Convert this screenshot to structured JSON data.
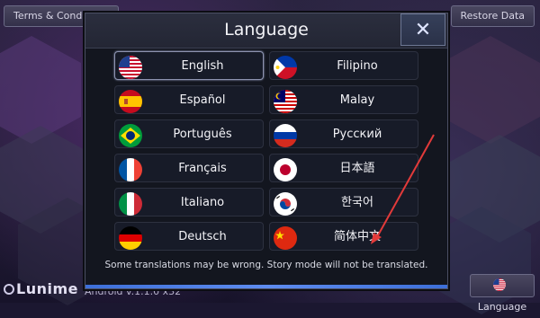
{
  "top_bar": {
    "terms_label": "Terms & Conditions",
    "restore_label": "Restore Data"
  },
  "footer": {
    "brand": "Lunime",
    "version": "Android v.1.1.0 x32",
    "language_button_label": "Language"
  },
  "dialog": {
    "title": "Language",
    "close_label": "✕",
    "note": "Some translations may be wrong. Story mode will not be translated.",
    "languages": [
      {
        "label": "English",
        "flag": "us",
        "selected": true
      },
      {
        "label": "Filipino",
        "flag": "ph"
      },
      {
        "label": "Español",
        "flag": "es"
      },
      {
        "label": "Malay",
        "flag": "my"
      },
      {
        "label": "Português",
        "flag": "br"
      },
      {
        "label": "Русский",
        "flag": "ru"
      },
      {
        "label": "Français",
        "flag": "fr"
      },
      {
        "label": "日本語",
        "flag": "jp"
      },
      {
        "label": "Italiano",
        "flag": "it"
      },
      {
        "label": "한국어",
        "flag": "kr"
      },
      {
        "label": "Deutsch",
        "flag": "de"
      },
      {
        "label": "简体中文",
        "flag": "cn"
      }
    ]
  },
  "colors": {
    "accent_blue": "#5e8cf0",
    "annotation_red": "#e23a3a",
    "dialog_bg": "#13161f"
  }
}
